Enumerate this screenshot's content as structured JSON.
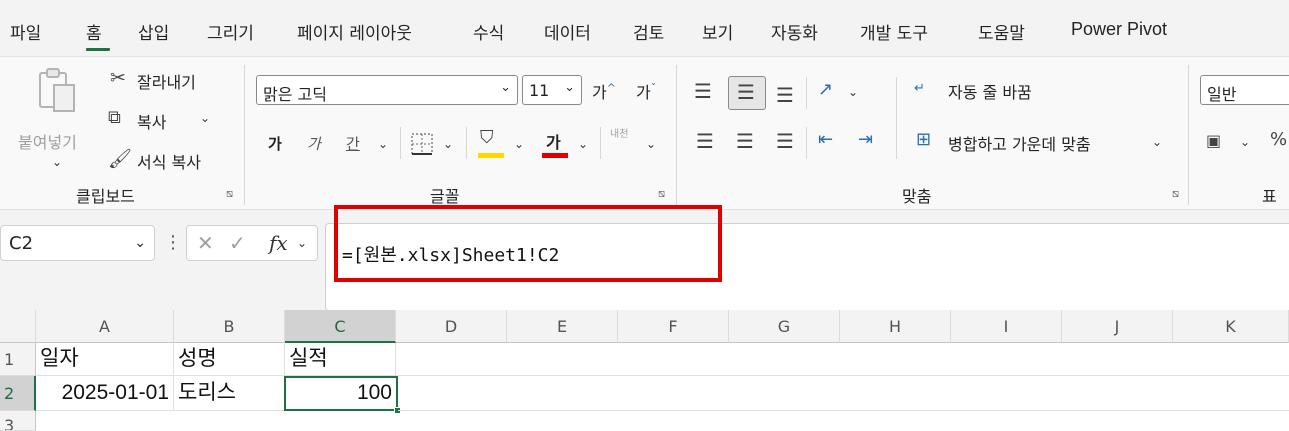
{
  "menu": {
    "tabs": [
      "파일",
      "홈",
      "삽입",
      "그리기",
      "페이지 레이아웃",
      "수식",
      "데이터",
      "검토",
      "보기",
      "자동화",
      "개발 도구",
      "도움말",
      "Power Pivot"
    ],
    "active_tab": "홈"
  },
  "ribbon": {
    "clipboard": {
      "paste_label": "붙여넣기",
      "cut_label": "잘라내기",
      "copy_label": "복사",
      "format_painter_label": "서식 복사",
      "group_label": "클립보드"
    },
    "font": {
      "font_name": "맑은 고딕",
      "font_size": "11",
      "grow_icon_label": "가",
      "shrink_icon_label": "가",
      "bold_label": "가",
      "italic_label": "가",
      "underline_label": "간",
      "font_color_label": "가",
      "phonetic_label": "내천",
      "group_label": "글꼴",
      "fill_color": "#ffd700",
      "font_color": "#e00000"
    },
    "alignment": {
      "wrap_text_label": "자동 줄 바꿈",
      "merge_center_label": "병합하고 가운데 맞춤",
      "group_label": "맞춤"
    },
    "number": {
      "format": "일반",
      "group_label": "표"
    }
  },
  "formula_bar": {
    "name_box": "C2",
    "formula": "=[원본.xlsx]Sheet1!C2",
    "fx_label": "fx"
  },
  "sheet": {
    "columns": [
      "A",
      "B",
      "C",
      "D",
      "E",
      "F",
      "G",
      "H",
      "I",
      "J",
      "K"
    ],
    "row_numbers": [
      "1",
      "2",
      "3"
    ],
    "selected_column": "C",
    "selected_row": "2",
    "rows": [
      [
        "일자",
        "성명",
        "실적"
      ],
      [
        "2025-01-01",
        "도리스",
        "100"
      ]
    ]
  },
  "colors": {
    "excel_green": "#1e7145",
    "highlight_red": "#e00000"
  }
}
